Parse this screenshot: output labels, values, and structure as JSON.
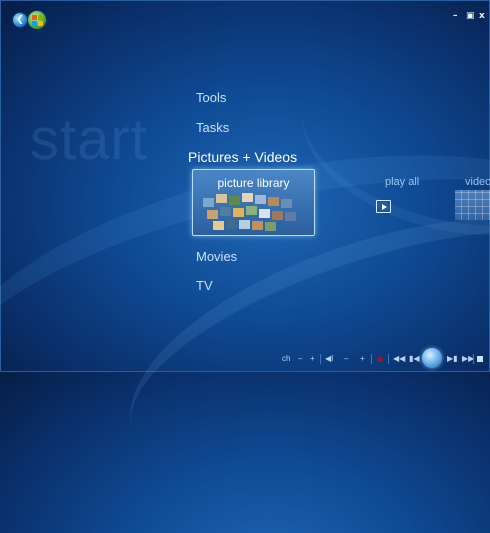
{
  "window": {
    "controls": {
      "minimize": "–",
      "restore": "Ђ",
      "close": "x"
    }
  },
  "background_word": "start",
  "menu": {
    "items": [
      "Tools",
      "Tasks",
      "Pictures + Videos",
      "Movies",
      "TV"
    ],
    "current_index": 2
  },
  "strip": {
    "picture_library": "picture library",
    "play_all": "play all",
    "video_partial": "video"
  },
  "transport": {
    "ch": "ch",
    "minus": "–",
    "plus": "+",
    "mute": "◀Ι",
    "rew": "◀◀",
    "prev": "▮◀",
    "next": "▶▮",
    "ffwd": "▶▶"
  },
  "colors": {
    "background": "#0f4a94",
    "accent": "#b8dcff",
    "record": "#8b1a2a"
  },
  "icons": [
    "back-icon",
    "windows-logo-icon",
    "play-icon",
    "record-icon",
    "play-orb-icon",
    "stop-icon"
  ]
}
